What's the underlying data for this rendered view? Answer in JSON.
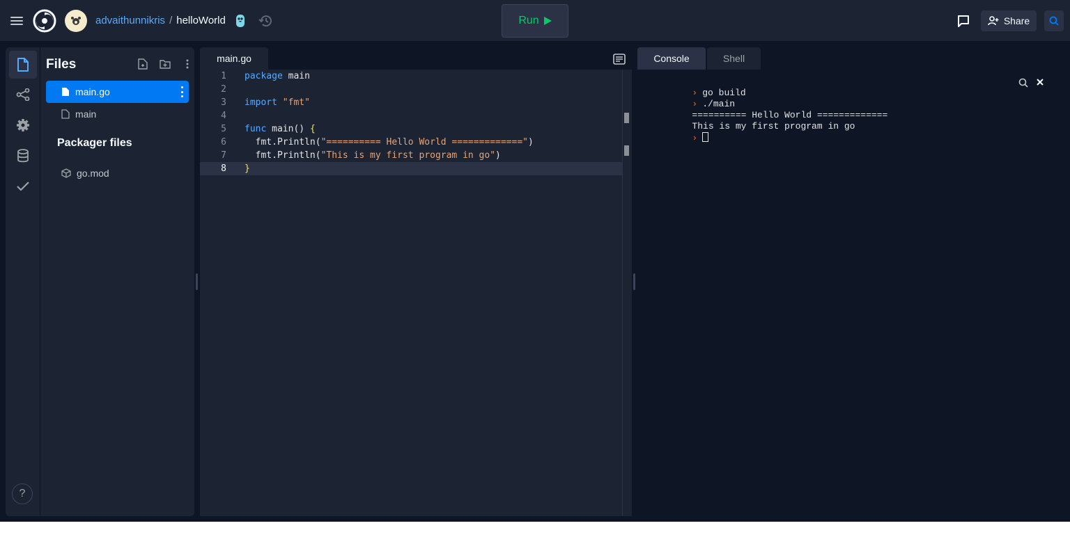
{
  "header": {
    "user": "advaithunnikris",
    "separator": "/",
    "repl_name": "helloWorld",
    "run_label": "Run",
    "share_label": "Share"
  },
  "sidebar": {
    "help_label": "?",
    "files_title": "Files",
    "files": [
      {
        "name": "main.go",
        "active": true
      },
      {
        "name": "main",
        "active": false
      }
    ],
    "packager_title": "Packager files",
    "packager_files": [
      {
        "name": "go.mod"
      }
    ]
  },
  "editor": {
    "tab_label": "main.go",
    "current_line": 8,
    "lines": [
      {
        "n": "1",
        "text": "package main"
      },
      {
        "n": "2",
        "text": ""
      },
      {
        "n": "3",
        "text": "import \"fmt\""
      },
      {
        "n": "4",
        "text": ""
      },
      {
        "n": "5",
        "text": "func main() {"
      },
      {
        "n": "6",
        "text": "  fmt.Println(\"========== Hello World =============\")"
      },
      {
        "n": "7",
        "text": "  fmt.Println(\"This is my first program in go\")"
      },
      {
        "n": "8",
        "text": "}"
      }
    ]
  },
  "console": {
    "tabs": [
      {
        "label": "Console",
        "active": true
      },
      {
        "label": "Shell",
        "active": false
      }
    ],
    "lines": [
      {
        "prompt": true,
        "text": "go build"
      },
      {
        "prompt": true,
        "text": "./main"
      },
      {
        "prompt": false,
        "text": "========== Hello World ============="
      },
      {
        "prompt": false,
        "text": "This is my first program in go"
      }
    ]
  },
  "colors": {
    "background": "#0e1525",
    "surface": "#1c2333",
    "accent": "#0079f2",
    "run_green": "#00cc66",
    "prompt_orange": "#f26522"
  },
  "icons": [
    "hamburger-icon",
    "replit-logo-icon",
    "go-language-icon",
    "history-icon",
    "play-icon",
    "chat-icon",
    "share-person-icon",
    "search-icon",
    "files-icon",
    "git-icon",
    "settings-icon",
    "database-icon",
    "check-icon",
    "new-file-icon",
    "new-folder-icon",
    "kebab-icon",
    "file-icon",
    "package-icon",
    "format-icon",
    "close-icon"
  ]
}
